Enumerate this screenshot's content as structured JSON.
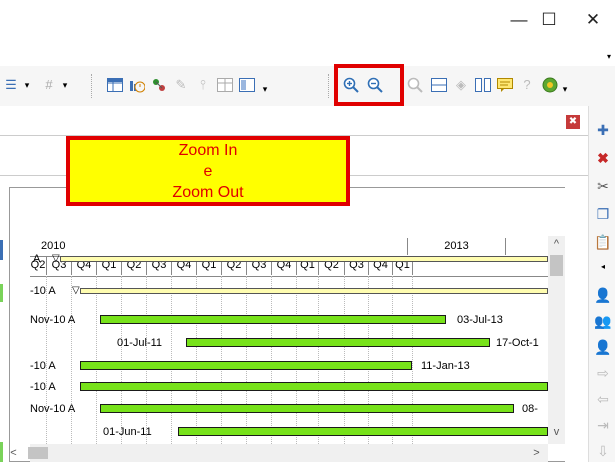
{
  "window": {
    "minimize_glyph": "—",
    "maximize_glyph": "☐",
    "close_glyph": "✕"
  },
  "toolbar": {
    "hash_glyph": "#",
    "dropdown_glyph": "▾",
    "icons": [
      "table-icon",
      "chart-clock-icon",
      "resource-icon",
      "filter-icon",
      "link-icon",
      "grid-icon",
      "layout-icon",
      "zoom-in-icon",
      "zoom-out-icon",
      "zoom-fit-icon",
      "rows-icon",
      "diamond-icon",
      "columns-icon",
      "comment-icon",
      "help-icon",
      "globe-icon"
    ]
  },
  "callout": {
    "line1": "Zoom In",
    "line2": "e",
    "line3": "Zoom Out",
    "bg_color": "#ffff00",
    "border_color": "#ff0000",
    "text_color": "#ff0000"
  },
  "panel": {
    "close_glyph": "✖"
  },
  "gantt": {
    "years": [
      "2010",
      "2013"
    ],
    "quarters": [
      "Q2",
      "Q3",
      "Q4",
      "Q1",
      "Q2",
      "Q3",
      "Q4",
      "Q1",
      "Q2",
      "Q3",
      "Q4",
      "Q1",
      "Q2",
      "Q3",
      "Q4",
      "Q1"
    ],
    "rows": [
      {
        "left_label": "A",
        "right_label": ""
      },
      {
        "left_label": "-10 A",
        "right_label": ""
      },
      {
        "left_label": "Nov-10 A",
        "right_label": "03-Jul-13"
      },
      {
        "left_label": "01-Jul-11",
        "right_label": "17-Oct-1"
      },
      {
        "left_label": "-10 A",
        "right_label": "11-Jan-13"
      },
      {
        "left_label": "-10 A",
        "right_label": ""
      },
      {
        "left_label": "Nov-10 A",
        "right_label": "08-"
      },
      {
        "left_label": "01-Jun-11",
        "right_label": ""
      }
    ],
    "bar_color": "#77e21a",
    "milestone_glyph": "▽"
  },
  "scroll": {
    "up": "^",
    "down": "v",
    "left": "<",
    "right": ">"
  }
}
